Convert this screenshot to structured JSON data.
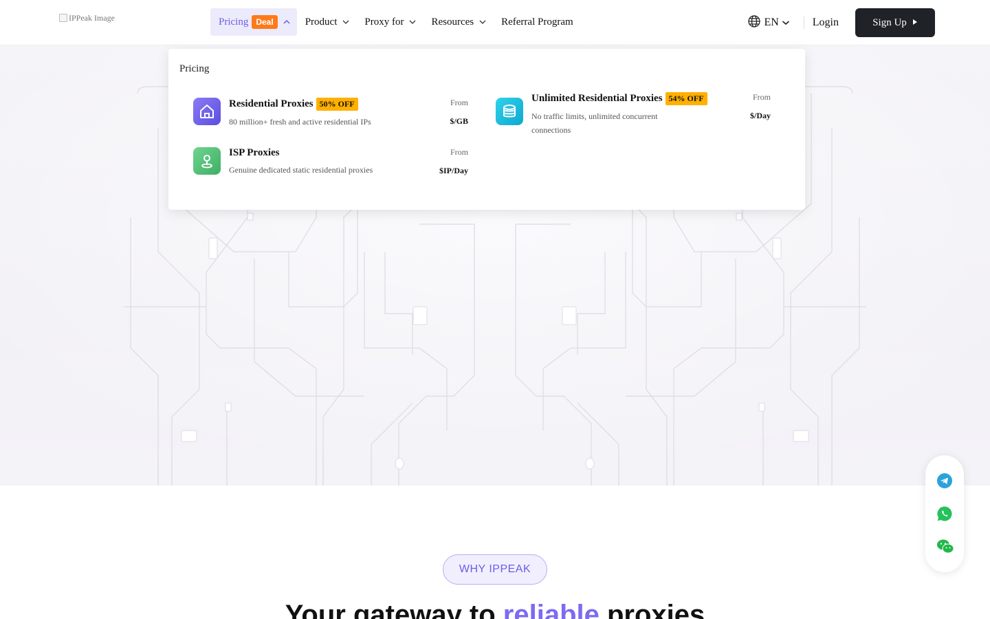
{
  "header": {
    "logo_alt": "IPPeak Image",
    "nav": [
      {
        "label": "Pricing",
        "badge": "Deal"
      },
      {
        "label": "Product"
      },
      {
        "label": "Proxy for"
      },
      {
        "label": "Resources"
      },
      {
        "label": "Referral Program"
      }
    ],
    "language": "EN",
    "login": "Login",
    "signup": "Sign Up"
  },
  "dropdown": {
    "title": "Pricing",
    "products": [
      {
        "name": "Residential Proxies",
        "badge": "50% OFF",
        "desc": "80 million+ fresh and active residential IPs",
        "from": "From",
        "price": "$/GB",
        "icon": "home-icon",
        "color": "#6b5ce7"
      },
      {
        "name": "ISP Proxies",
        "desc": "Genuine dedicated static residential proxies",
        "from": "From",
        "price": "$IP/Day",
        "icon": "location-pin-icon",
        "color": "#4cbf73"
      },
      {
        "name": "Unlimited Residential Proxies",
        "badge": "54% OFF",
        "desc_line1": "No traffic limits, unlimited concurrent",
        "desc_line2": "connections",
        "from": "From",
        "price": "$/Day",
        "icon": "database-icon",
        "color": "#16b9d9"
      }
    ]
  },
  "contact": [
    "telegram-icon",
    "whatsapp-icon",
    "wechat-icon"
  ],
  "why": {
    "badge": "WHY IPPEAK",
    "headline_pre": "Your gateway to ",
    "headline_highlight": "reliable",
    "headline_post": " proxies"
  },
  "colors": {
    "accent": "#6b5ce7",
    "deal": "#ff7a1a",
    "off": "#ffb000",
    "dark": "#1f2227"
  }
}
